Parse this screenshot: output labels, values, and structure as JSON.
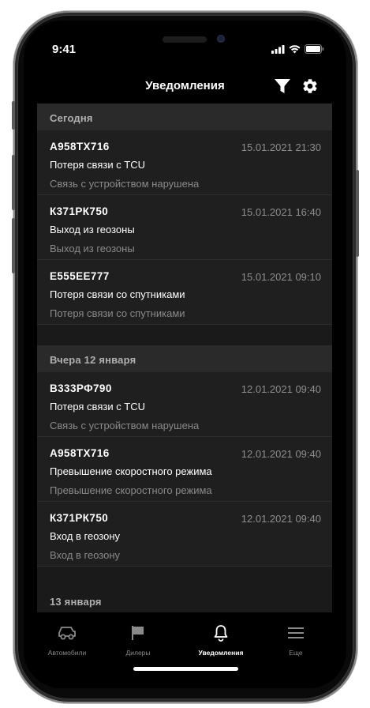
{
  "status": {
    "time": "9:41"
  },
  "header": {
    "title": "Уведомления",
    "filter_icon": "filter-icon",
    "settings_icon": "gear-icon"
  },
  "sections": [
    {
      "label": "Сегодня",
      "items": [
        {
          "plate": "А958ТХ716",
          "date": "15.01.2021 21:30",
          "title": "Потеря связи с TCU",
          "description": "Связь с устройством нарушена"
        },
        {
          "plate": "К371РК750",
          "date": "15.01.2021 16:40",
          "title": "Выход из геозоны",
          "description": "Выход из геозоны"
        },
        {
          "plate": "Е555ЕЕ777",
          "date": "15.01.2021 09:10",
          "title": "Потеря связи со спутниками",
          "description": "Потеря связи со спутниками"
        }
      ]
    },
    {
      "label": "Вчера 12 января",
      "items": [
        {
          "plate": "В333РФ790",
          "date": "12.01.2021 09:40",
          "title": "Потеря связи с TCU",
          "description": "Связь с устройством нарушена"
        },
        {
          "plate": "А958ТХ716",
          "date": "12.01.2021 09:40",
          "title": "Превышение скоростного режима",
          "description": "Превышение скоростного режима"
        },
        {
          "plate": "К371РК750",
          "date": "12.01.2021 09:40",
          "title": "Вход в геозону",
          "description": "Вход в геозону"
        }
      ]
    },
    {
      "label": "13 января",
      "items": []
    }
  ],
  "tabs": [
    {
      "label": "Автомобили",
      "icon": "car-icon",
      "active": false
    },
    {
      "label": "Дилеры",
      "icon": "flag-icon",
      "active": false
    },
    {
      "label": "Уведомления",
      "icon": "bell-icon",
      "active": true
    },
    {
      "label": "Еще",
      "icon": "menu-icon",
      "active": false
    }
  ]
}
